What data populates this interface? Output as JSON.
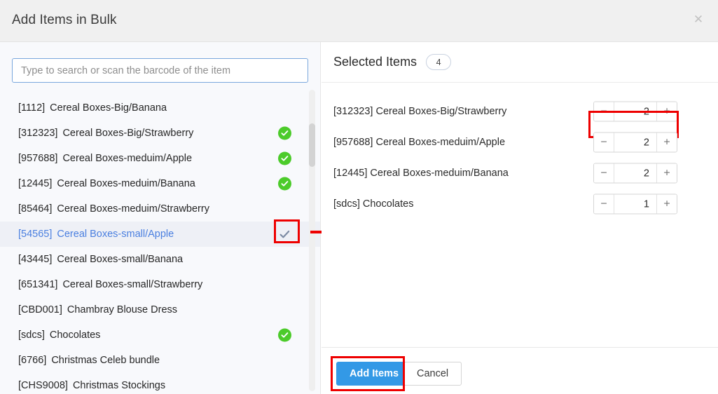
{
  "dialog": {
    "title": "Add Items in Bulk",
    "close_icon": "close-icon"
  },
  "search": {
    "placeholder": "Type to search or scan the barcode of the item",
    "value": ""
  },
  "item_list": [
    {
      "code": "[1112]",
      "name": "Cereal Boxes-Big/Banana",
      "state": "none"
    },
    {
      "code": "[312323]",
      "name": "Cereal Boxes-Big/Strawberry",
      "state": "added"
    },
    {
      "code": "[957688]",
      "name": "Cereal Boxes-meduim/Apple",
      "state": "added"
    },
    {
      "code": "[12445]",
      "name": "Cereal Boxes-meduim/Banana",
      "state": "added"
    },
    {
      "code": "[85464]",
      "name": "Cereal Boxes-meduim/Strawberry",
      "state": "none"
    },
    {
      "code": "[54565]",
      "name": "Cereal Boxes-small/Apple",
      "state": "hover"
    },
    {
      "code": "[43445]",
      "name": "Cereal Boxes-small/Banana",
      "state": "none"
    },
    {
      "code": "[651341]",
      "name": "Cereal Boxes-small/Strawberry",
      "state": "none"
    },
    {
      "code": "[CBD001]",
      "name": "Chambray Blouse Dress",
      "state": "none"
    },
    {
      "code": "[sdcs]",
      "name": "Chocolates",
      "state": "added"
    },
    {
      "code": "[6766]",
      "name": "Christmas Celeb bundle",
      "state": "none"
    },
    {
      "code": "[CHS9008]",
      "name": "Christmas Stockings",
      "state": "none"
    }
  ],
  "selected": {
    "title": "Selected Items",
    "count": "4",
    "rows": [
      {
        "label": "[312323] Cereal Boxes-Big/Strawberry",
        "qty": "2",
        "minus": "−",
        "plus": "+"
      },
      {
        "label": "[957688] Cereal Boxes-meduim/Apple",
        "qty": "2",
        "minus": "−",
        "plus": "+"
      },
      {
        "label": "[12445] Cereal Boxes-meduim/Banana",
        "qty": "2",
        "minus": "−",
        "plus": "+"
      },
      {
        "label": "[sdcs] Chocolates",
        "qty": "1",
        "minus": "−",
        "plus": "+"
      }
    ]
  },
  "footer": {
    "add_label": "Add Items",
    "cancel_label": "Cancel"
  },
  "colors": {
    "accent_blue": "#3399e6",
    "link_blue": "#4a7fe0",
    "check_green": "#4ccb2a",
    "annotation_red": "#ee0000",
    "header_bg": "#f0f0f0",
    "left_panel_bg": "#f8f9fc"
  }
}
